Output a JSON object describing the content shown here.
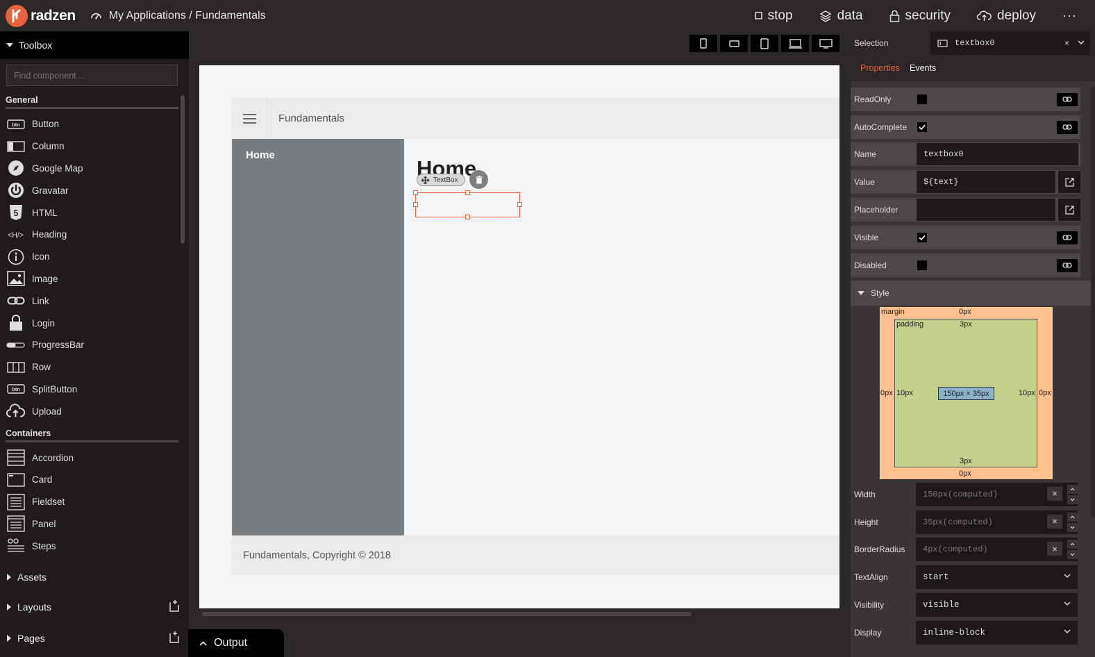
{
  "brand": {
    "name": "radzen",
    "accent": "#e8623d"
  },
  "breadcrumb": "My Applications / Fundamentals",
  "top_actions": [
    {
      "label": "stop",
      "icon": "stop-icon"
    },
    {
      "label": "data",
      "icon": "layers-icon"
    },
    {
      "label": "security",
      "icon": "lock-icon"
    },
    {
      "label": "deploy",
      "icon": "cloud-upload-icon"
    }
  ],
  "more_label": "···",
  "toolbox": {
    "title": "Toolbox",
    "search_placeholder": "Find component ...",
    "general_title": "General",
    "general": [
      "Button",
      "Column",
      "Google Map",
      "Gravatar",
      "HTML",
      "Heading",
      "Icon",
      "Image",
      "Link",
      "Login",
      "ProgressBar",
      "Row",
      "SplitButton",
      "Upload"
    ],
    "containers_title": "Containers",
    "containers": [
      "Accordion",
      "Card",
      "Fieldset",
      "Panel",
      "Steps"
    ],
    "sections": [
      "Assets",
      "Layouts",
      "Pages"
    ]
  },
  "output_label": "Output",
  "preview": {
    "app_title": "Fundamentals",
    "nav_item": "Home",
    "heading": "Home",
    "selection_tag": "TextBox",
    "footer": "Fundamentals, Copyright © 2018"
  },
  "properties": {
    "selection_label": "Selection",
    "selection_value": "textbox0",
    "tabs": [
      "Properties",
      "Events"
    ],
    "rows": {
      "readonly": {
        "label": "ReadOnly",
        "checked": false
      },
      "autocomplete": {
        "label": "AutoComplete",
        "checked": true
      },
      "name": {
        "label": "Name",
        "value": "textbox0"
      },
      "value": {
        "label": "Value",
        "value": "${text}"
      },
      "placeholder": {
        "label": "Placeholder",
        "value": ""
      },
      "visible": {
        "label": "Visible",
        "checked": true
      },
      "disabled": {
        "label": "Disabled",
        "checked": false
      }
    },
    "style_title": "Style",
    "box_model": {
      "margin_label": "margin",
      "padding_label": "padding",
      "margin_top": "0px",
      "margin_bottom": "0px",
      "margin_left": "0px",
      "margin_right": "0px",
      "padding_top": "3px",
      "padding_bottom": "3px",
      "padding_left": "10px",
      "padding_right": "10px",
      "size": "150px × 35px"
    },
    "width": {
      "label": "Width",
      "value": "150px(computed)"
    },
    "height": {
      "label": "Height",
      "value": "35px(computed)"
    },
    "border_radius": {
      "label": "BorderRadius",
      "value": "4px(computed)"
    },
    "text_align": {
      "label": "TextAlign",
      "value": "start"
    },
    "visibility": {
      "label": "Visibility",
      "value": "visible"
    },
    "display": {
      "label": "Display",
      "value": "inline-block"
    }
  }
}
